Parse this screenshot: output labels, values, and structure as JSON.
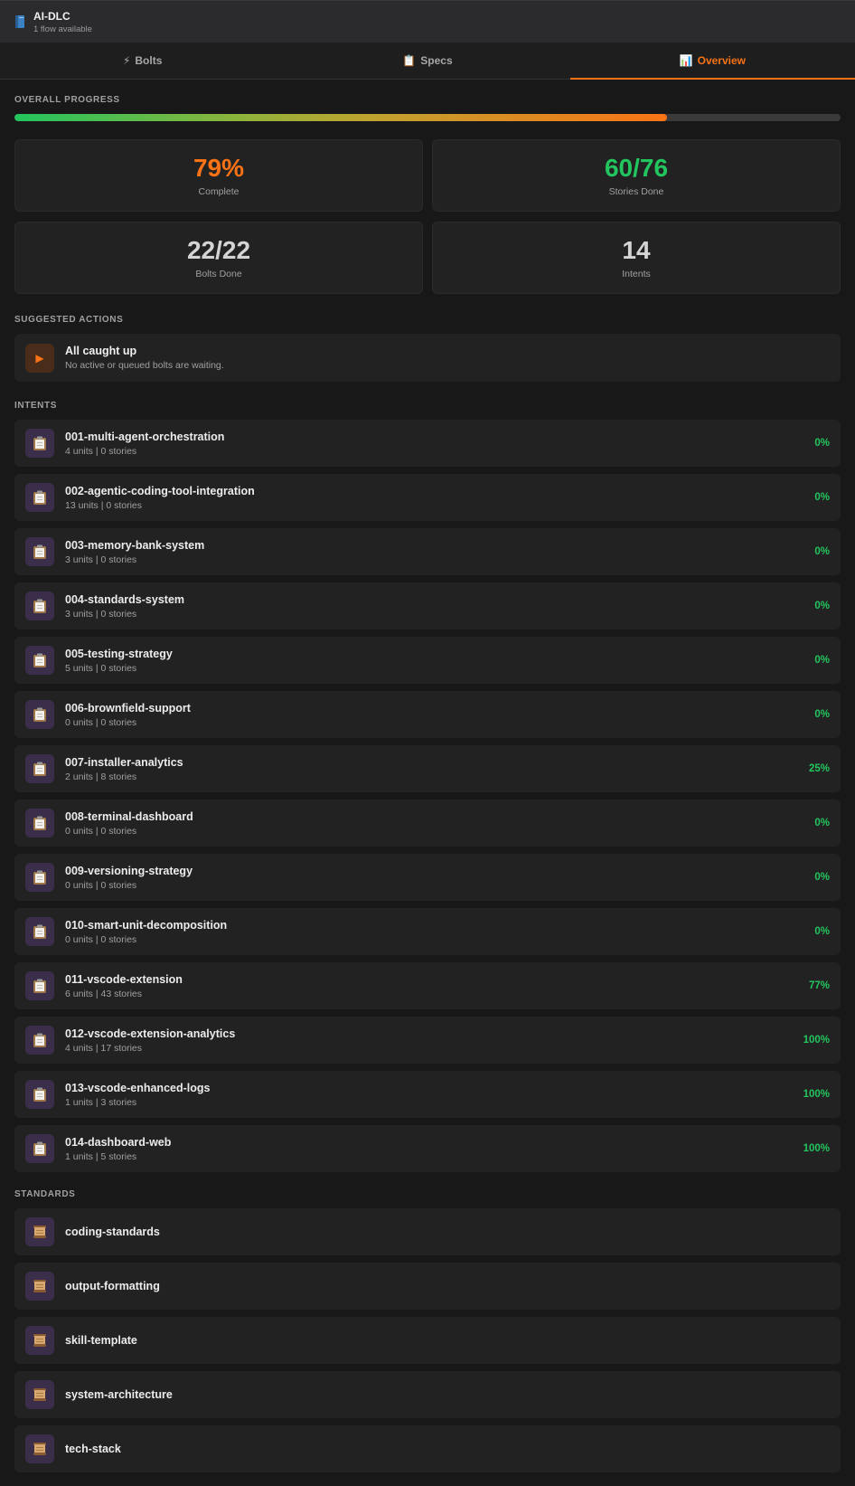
{
  "header": {
    "title": "AI-DLC",
    "subtitle": "1 flow available",
    "icon": "book-icon"
  },
  "tabs": [
    {
      "label": "Bolts",
      "icon": "lightning-icon",
      "glyph": "⚡",
      "active": false
    },
    {
      "label": "Specs",
      "icon": "clipboard-icon",
      "glyph": "📋",
      "active": false
    },
    {
      "label": "Overview",
      "icon": "chart-icon",
      "glyph": "📊",
      "active": true
    }
  ],
  "progress": {
    "label": "OVERALL PROGRESS",
    "percent": 79
  },
  "stats": [
    {
      "value": "79%",
      "label": "Complete",
      "color": "#f97316"
    },
    {
      "value": "60/76",
      "label": "Stories Done",
      "color": "#22c55e"
    },
    {
      "value": "22/22",
      "label": "Bolts Done",
      "color": "#d4d4d4"
    },
    {
      "value": "14",
      "label": "Intents",
      "color": "#d4d4d4"
    }
  ],
  "suggested": {
    "label": "SUGGESTED ACTIONS",
    "title": "All caught up",
    "subtitle": "No active or queued bolts are waiting.",
    "icon": "play-icon"
  },
  "intents": {
    "label": "INTENTS",
    "items": [
      {
        "name": "001-multi-agent-orchestration",
        "meta": "4 units | 0 stories",
        "pct": "0%"
      },
      {
        "name": "002-agentic-coding-tool-integration",
        "meta": "13 units | 0 stories",
        "pct": "0%"
      },
      {
        "name": "003-memory-bank-system",
        "meta": "3 units | 0 stories",
        "pct": "0%"
      },
      {
        "name": "004-standards-system",
        "meta": "3 units | 0 stories",
        "pct": "0%"
      },
      {
        "name": "005-testing-strategy",
        "meta": "5 units | 0 stories",
        "pct": "0%"
      },
      {
        "name": "006-brownfield-support",
        "meta": "0 units | 0 stories",
        "pct": "0%"
      },
      {
        "name": "007-installer-analytics",
        "meta": "2 units | 8 stories",
        "pct": "25%"
      },
      {
        "name": "008-terminal-dashboard",
        "meta": "0 units | 0 stories",
        "pct": "0%"
      },
      {
        "name": "009-versioning-strategy",
        "meta": "0 units | 0 stories",
        "pct": "0%"
      },
      {
        "name": "010-smart-unit-decomposition",
        "meta": "0 units | 0 stories",
        "pct": "0%"
      },
      {
        "name": "011-vscode-extension",
        "meta": "6 units | 43 stories",
        "pct": "77%"
      },
      {
        "name": "012-vscode-extension-analytics",
        "meta": "4 units | 17 stories",
        "pct": "100%"
      },
      {
        "name": "013-vscode-enhanced-logs",
        "meta": "1 units | 3 stories",
        "pct": "100%"
      },
      {
        "name": "014-dashboard-web",
        "meta": "1 units | 5 stories",
        "pct": "100%"
      }
    ]
  },
  "standards": {
    "label": "STANDARDS",
    "items": [
      {
        "name": "coding-standards"
      },
      {
        "name": "output-formatting"
      },
      {
        "name": "skill-template"
      },
      {
        "name": "system-architecture"
      },
      {
        "name": "tech-stack"
      }
    ]
  }
}
